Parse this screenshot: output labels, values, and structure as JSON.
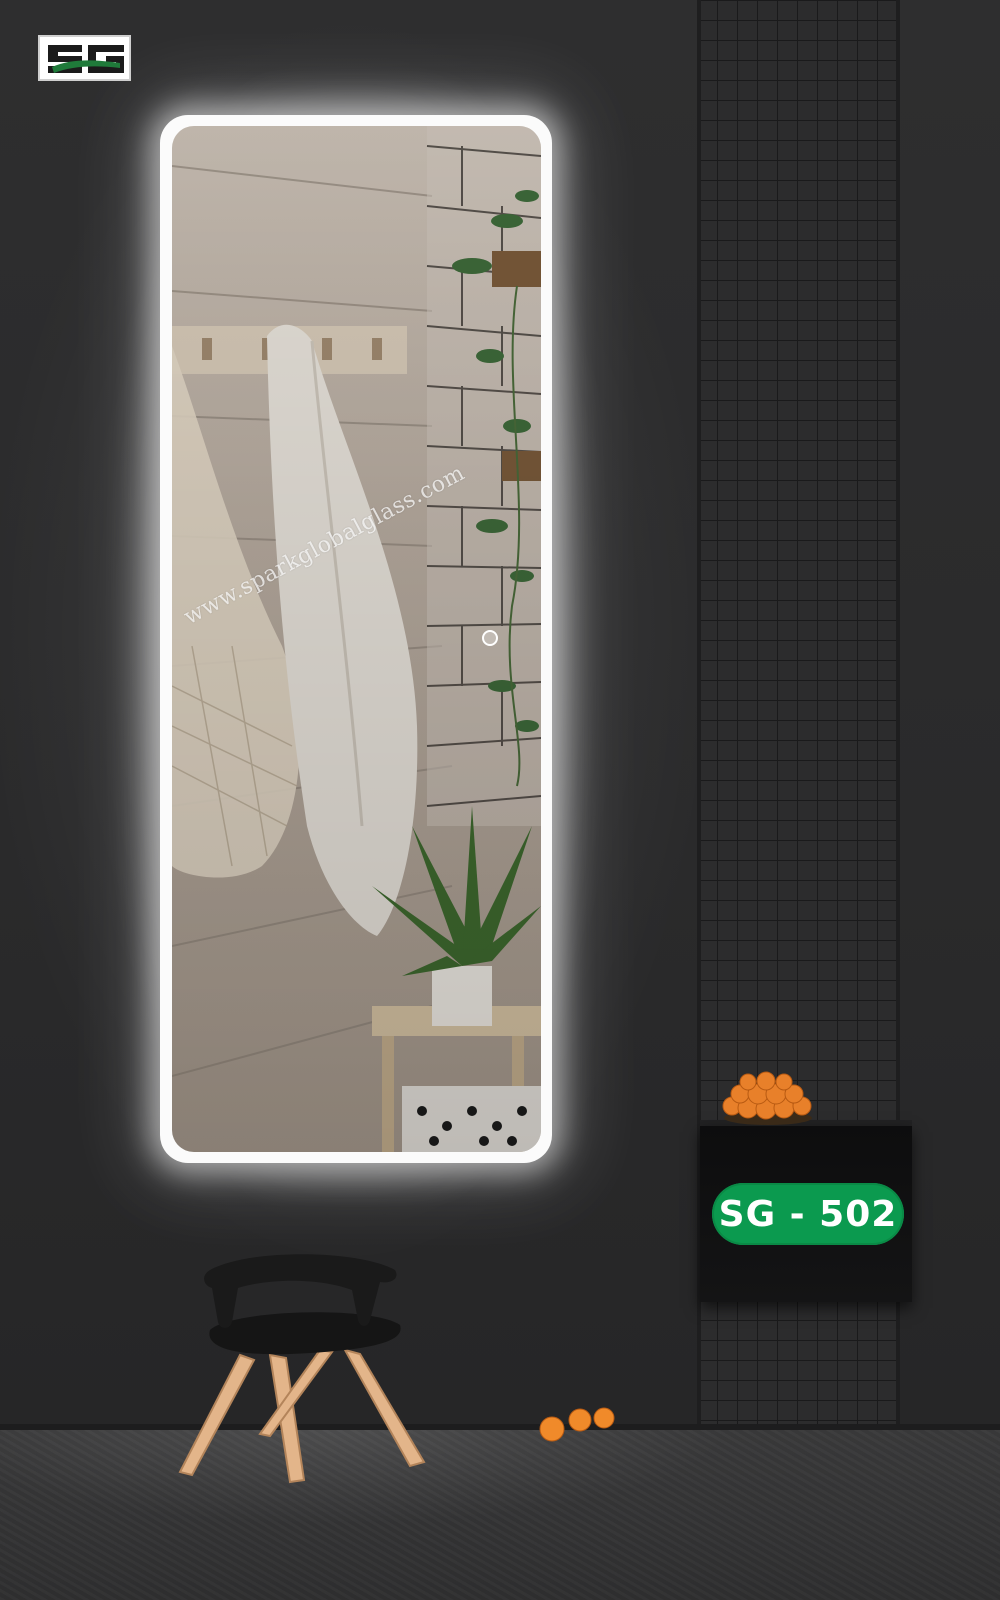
{
  "brand": {
    "logo_text": "SG",
    "logo_colors": {
      "dark": "#1b1b1b",
      "green": "#1f7a3a"
    }
  },
  "product": {
    "model_label": "SG - 502",
    "badge_color": "#0b9a4f"
  },
  "watermark": {
    "text": "www.sparkglobalglass.com"
  },
  "icons": {
    "touch_sensor": "touch-sensor-icon"
  }
}
